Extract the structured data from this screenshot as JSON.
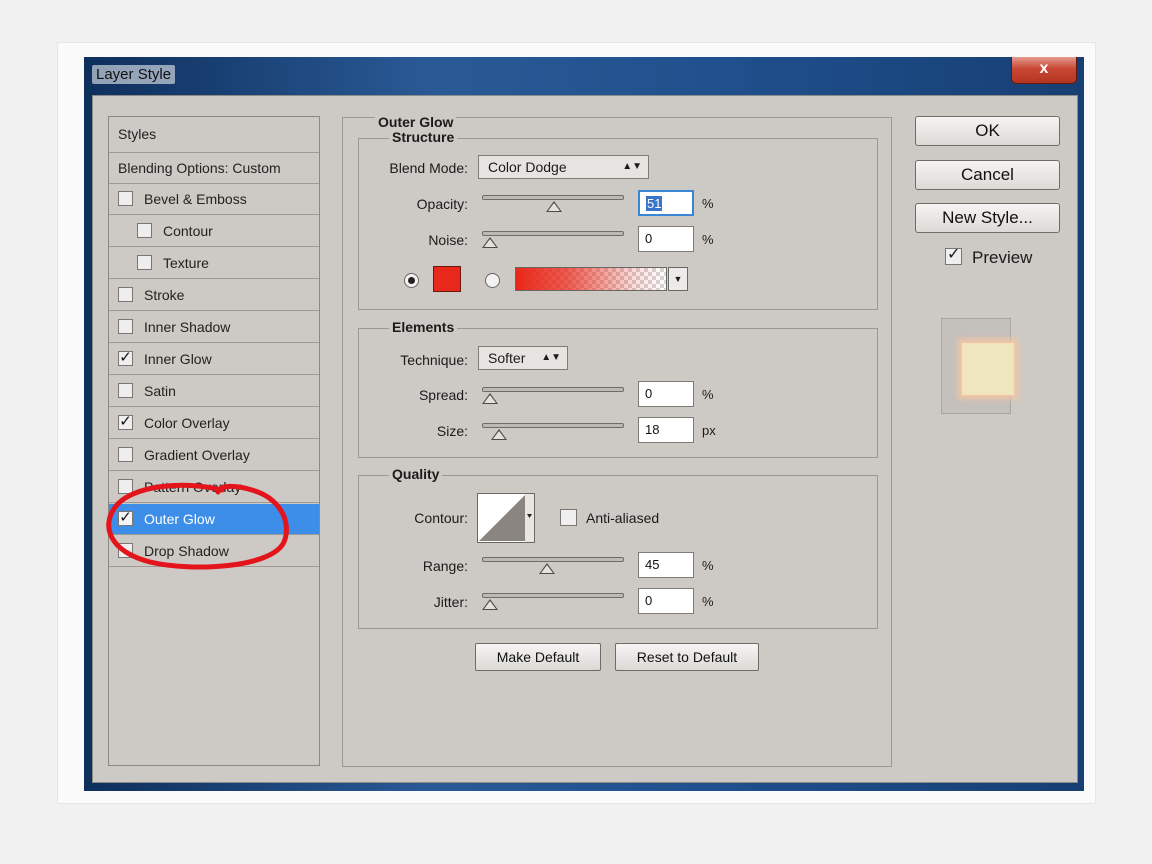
{
  "window": {
    "title": "Layer Style",
    "close_label": "x"
  },
  "style_list": {
    "header_styles": "Styles",
    "header_blending": "Blending Options: Custom",
    "items": [
      {
        "label": "Bevel & Emboss",
        "checked": false
      },
      {
        "label": "Contour",
        "checked": false
      },
      {
        "label": "Texture",
        "checked": false
      },
      {
        "label": "Stroke",
        "checked": false
      },
      {
        "label": "Inner Shadow",
        "checked": false
      },
      {
        "label": "Inner Glow",
        "checked": true
      },
      {
        "label": "Satin",
        "checked": false
      },
      {
        "label": "Color Overlay",
        "checked": true
      },
      {
        "label": "Gradient Overlay",
        "checked": false
      },
      {
        "label": "Pattern Overlay",
        "checked": false
      },
      {
        "label": "Outer Glow",
        "checked": true,
        "selected": true
      },
      {
        "label": "Drop Shadow",
        "checked": false
      }
    ],
    "check_glyph": "✓"
  },
  "outer_glow": {
    "title": "Outer Glow",
    "structure": {
      "title": "Structure",
      "blend_mode_label": "Blend Mode:",
      "blend_mode_value": "Color Dodge",
      "opacity_label": "Opacity:",
      "opacity_value": "51",
      "opacity_level": 0.51,
      "noise_label": "Noise:",
      "noise_value": "0",
      "noise_level": 0,
      "unit_percent": "%",
      "glow_color": "#e8281a"
    },
    "elements": {
      "title": "Elements",
      "technique_label": "Technique:",
      "technique_value": "Softer",
      "spread_label": "Spread:",
      "spread_value": "0",
      "spread_level": 0,
      "size_label": "Size:",
      "size_value": "18",
      "size_level": 0.07,
      "unit_px": "px"
    },
    "quality": {
      "title": "Quality",
      "contour_label": "Contour:",
      "anti_aliased_label": "Anti-aliased",
      "anti_aliased_checked": false,
      "range_label": "Range:",
      "range_value": "45",
      "range_level": 0.45,
      "jitter_label": "Jitter:",
      "jitter_value": "0",
      "jitter_level": 0
    },
    "make_default_label": "Make Default",
    "reset_default_label": "Reset to Default"
  },
  "actions": {
    "ok_label": "OK",
    "cancel_label": "Cancel",
    "new_style_label": "New Style...",
    "preview_label": "Preview",
    "preview_checked": true
  },
  "colors": {
    "selection": "#3d8ee8",
    "glow": "#e8281a",
    "annotation": "#e4141c"
  }
}
